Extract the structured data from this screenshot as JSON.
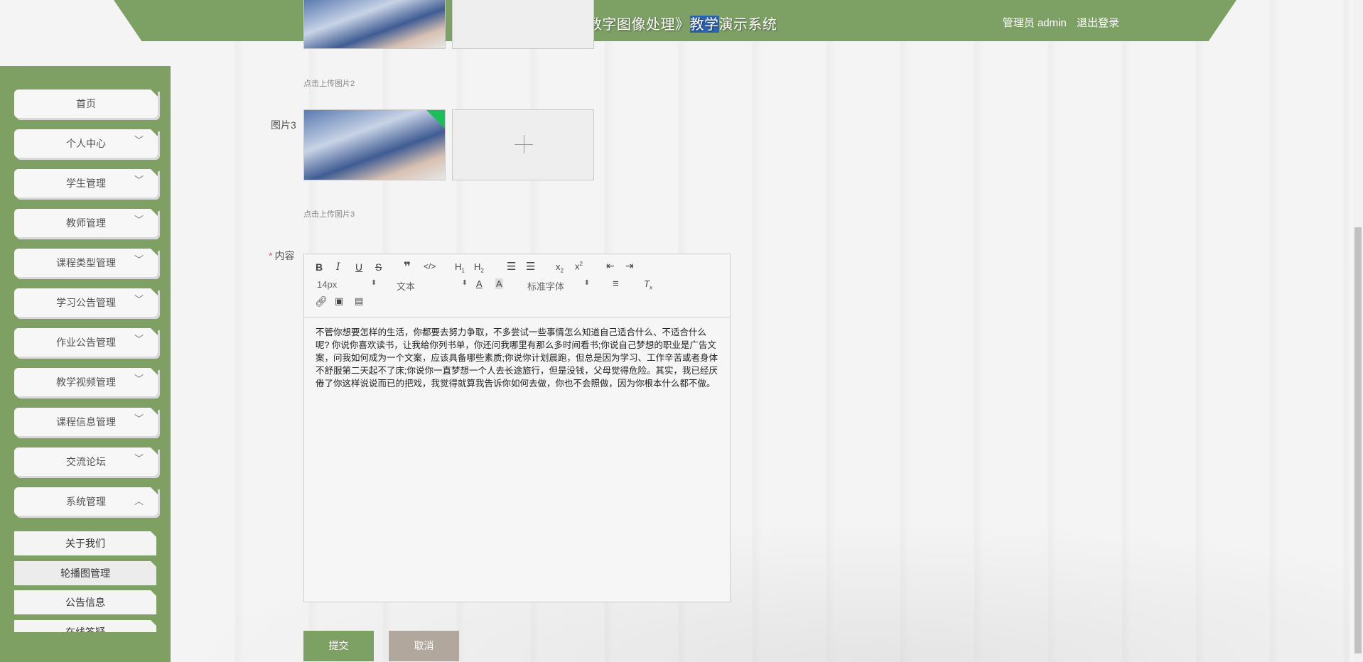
{
  "header": {
    "title_pre": "《数字图像处理》",
    "title_highlight": "教学",
    "title_post": "演示系统",
    "user_label": "管理员 admin",
    "logout": "退出登录"
  },
  "sidebar": {
    "items": [
      {
        "label": "首页",
        "chevron": ""
      },
      {
        "label": "个人中心",
        "chevron": "﹀"
      },
      {
        "label": "学生管理",
        "chevron": "﹀"
      },
      {
        "label": "教师管理",
        "chevron": "﹀"
      },
      {
        "label": "课程类型管理",
        "chevron": "﹀"
      },
      {
        "label": "学习公告管理",
        "chevron": "﹀"
      },
      {
        "label": "作业公告管理",
        "chevron": "﹀"
      },
      {
        "label": "教学视频管理",
        "chevron": "﹀"
      },
      {
        "label": "课程信息管理",
        "chevron": "﹀"
      },
      {
        "label": "交流论坛",
        "chevron": "﹀"
      },
      {
        "label": "系统管理",
        "chevron": "︿"
      }
    ],
    "sub_items": [
      {
        "label": "关于我们"
      },
      {
        "label": "轮播图管理"
      },
      {
        "label": "公告信息"
      },
      {
        "label": "在线答疑"
      }
    ]
  },
  "form": {
    "hint2": "点击上传图片2",
    "label3": "图片3",
    "hint3": "点击上传图片3",
    "content_label": "内容",
    "required_mark": "*",
    "editor": {
      "font_size": "14px",
      "block_type": "文本",
      "font_family": "标准字体",
      "content": "不管你想要怎样的生活，你都要去努力争取，不多尝试一些事情怎么知道自己适合什么、不适合什么呢? 你说你喜欢读书，让我给你列书单，你还问我哪里有那么多时间看书;你说自己梦想的职业是广告文案，问我如何成为一个文案，应该具备哪些素质;你说你计划晨跑，但总是因为学习、工作辛苦或者身体不舒服第二天起不了床;你说你一直梦想一个人去长途旅行，但是没钱，父母觉得危险。其实，我已经厌倦了你这样说说而已的把戏，我觉得就算我告诉你如何去做，你也不会照做，因为你根本什么都不做。"
    },
    "submit": "提交",
    "cancel": "取消"
  }
}
